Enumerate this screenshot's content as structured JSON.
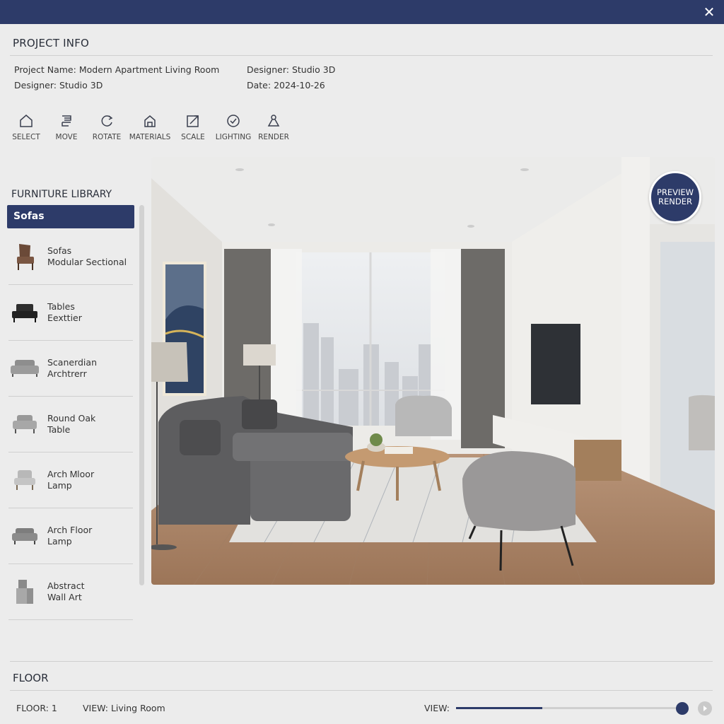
{
  "window": {
    "close_glyph": "✕"
  },
  "project_info": {
    "title": "PROJECT INFO",
    "left_col": [
      {
        "label": "Project Name:",
        "value": "Modern Apartment Living Room"
      },
      {
        "label": "Designer:",
        "value": "Studio 3D"
      }
    ],
    "right_col": [
      {
        "label": "Designer:",
        "value": "Studio 3D"
      },
      {
        "label": "Date:",
        "value": "2024-10-26"
      }
    ]
  },
  "toolbar": {
    "tools": [
      {
        "label": "SELECT",
        "icon": "home-select-icon"
      },
      {
        "label": "MOVE",
        "icon": "move-icon"
      },
      {
        "label": "ROTATE",
        "icon": "rotate-icon"
      },
      {
        "label": "MATERIALS",
        "icon": "materials-icon"
      },
      {
        "label": "SCALE",
        "icon": "scale-icon"
      },
      {
        "label": "LIGHTING",
        "icon": "lighting-check-icon"
      },
      {
        "label": "RENDER",
        "icon": "render-flask-icon"
      }
    ]
  },
  "library": {
    "title": "FURNITURE LIBRARY",
    "selected_category": "Sofas",
    "items": [
      {
        "line1": "Sofas",
        "line2": "Modular Sectional",
        "icon": "armchair-icon"
      },
      {
        "line1": "Tables",
        "line2": "Eexttier",
        "icon": "black-sofa-icon"
      },
      {
        "line1": "Scanerdian",
        "line2": "Archtrerr",
        "icon": "grey-sofa-icon"
      },
      {
        "line1": "Round Oak",
        "line2": "Table",
        "icon": "grey-armchair-icon"
      },
      {
        "line1": "Arch Ꮇloor",
        "line2": "Lamp",
        "icon": "light-armchair-icon"
      },
      {
        "line1": "Arch Floor",
        "line2": "Lamp",
        "icon": "small-sofa-icon"
      },
      {
        "line1": "Abstract",
        "line2": "Wall Art",
        "icon": "cube-icon"
      }
    ]
  },
  "viewport": {
    "preview_button": {
      "line1": "PREVIEW",
      "line2": "RENDER"
    }
  },
  "floor": {
    "title": "FLOOR",
    "floor_label": "FLOOR: 1",
    "view_label": "VIEW: Living Room",
    "slider_label": "VIEW:",
    "slider_progress": 0.38
  },
  "colors": {
    "accent": "#2d3b69",
    "background": "#ececec"
  }
}
